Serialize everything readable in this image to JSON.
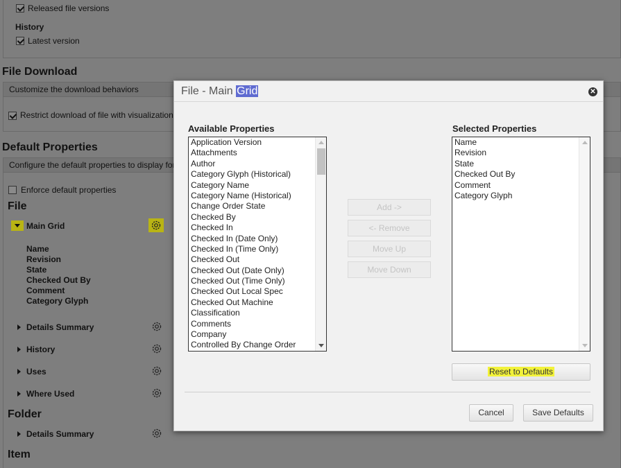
{
  "background": {
    "released_file_versions": "Released file versions",
    "history_label": "History",
    "latest_version": "Latest version",
    "file_download_title": "File Download",
    "file_download_header": "Customize the download behaviors",
    "restrict_download": "Restrict download of file with visualization",
    "default_properties_title": "Default Properties",
    "default_properties_header": "Configure the default properties to display for",
    "enforce_default": "Enforce default properties",
    "file_heading": "File",
    "main_grid": "Main Grid",
    "main_grid_fields": [
      "Name",
      "Revision",
      "State",
      "Checked Out By",
      "Comment",
      "Category Glyph"
    ],
    "details_summary": "Details Summary",
    "history": "History",
    "uses": "Uses",
    "where_used": "Where Used",
    "folder_heading": "Folder",
    "folder_details_summary": "Details Summary",
    "item_heading": "Item"
  },
  "dialog": {
    "title_prefix": "File - Main ",
    "title_highlight": "Grid",
    "available_label": "Available Properties",
    "selected_label": "Selected Properties",
    "available_items": [
      "Application Version",
      "Attachments",
      "Author",
      "Category Glyph (Historical)",
      "Category Name",
      "Category Name (Historical)",
      "Change Order State",
      "Checked By",
      "Checked In",
      "Checked In (Date Only)",
      "Checked In (Time Only)",
      "Checked Out",
      "Checked Out (Date Only)",
      "Checked Out (Time Only)",
      "Checked Out Local Spec",
      "Checked Out Machine",
      "Classification",
      "Comments",
      "Company",
      "Controlled By Change Order"
    ],
    "selected_items": [
      "Name",
      "Revision",
      "State",
      "Checked Out By",
      "Comment",
      "Category Glyph"
    ],
    "add_label": "Add ->",
    "remove_label": "<- Remove",
    "move_up_label": "Move Up",
    "move_down_label": "Move Down",
    "reset_label": "Reset to Defaults",
    "cancel_label": "Cancel",
    "save_label": "Save Defaults"
  },
  "colors": {
    "highlight": "#f2f23a",
    "title_selection": "#5f6bd1"
  }
}
